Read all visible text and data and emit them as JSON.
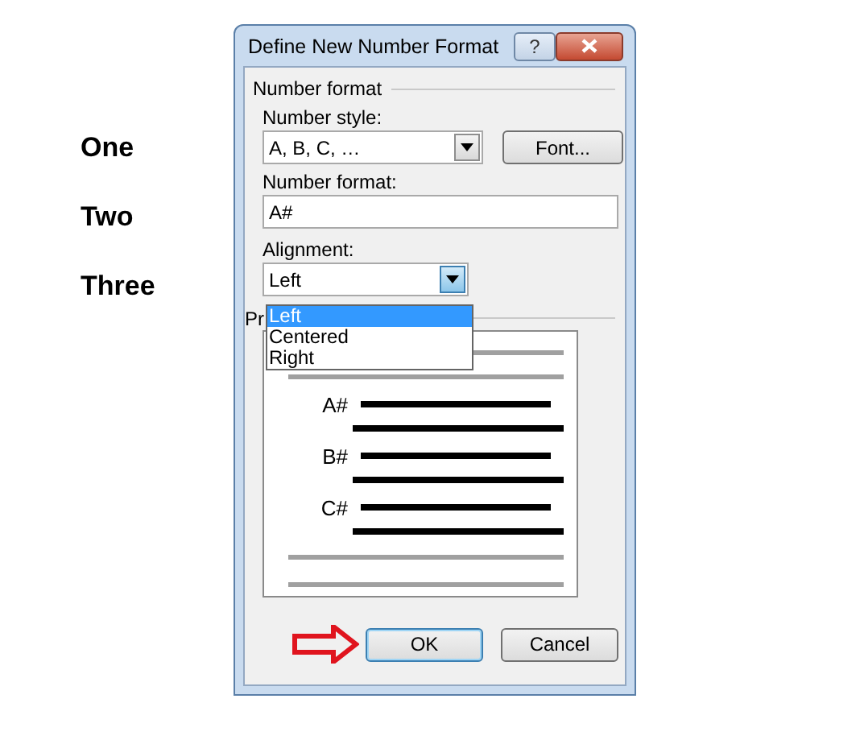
{
  "side_labels": [
    "One",
    "Two",
    "Three"
  ],
  "dialog": {
    "title": "Define New Number Format",
    "help_button": "?",
    "number_format_group": "Number format",
    "number_style": {
      "label": "Number style:",
      "value": "A, B, C, …"
    },
    "font_button": "Font...",
    "number_format": {
      "label": "Number format:",
      "value": "A#"
    },
    "alignment": {
      "label": "Alignment:",
      "value": "Left",
      "expanded": true,
      "options": [
        {
          "label": "Left",
          "selected": true
        },
        {
          "label": "Centered",
          "selected": false
        },
        {
          "label": "Right",
          "selected": false
        }
      ]
    },
    "preview_group": "Pr",
    "preview_labels": [
      "A#",
      "B#",
      "C#"
    ],
    "buttons": [
      {
        "label": "OK",
        "default": true
      },
      {
        "label": "Cancel",
        "default": false
      }
    ]
  }
}
